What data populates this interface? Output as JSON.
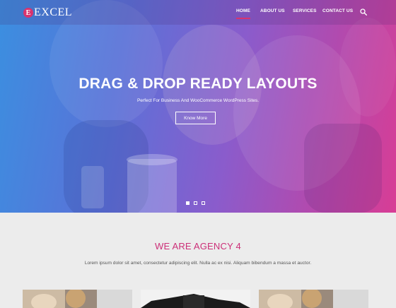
{
  "brand": {
    "badge": "E",
    "name": "EXCEL"
  },
  "nav": [
    {
      "label": "HOME",
      "active": true
    },
    {
      "label": "ABOUT US"
    },
    {
      "label": "SERVICES"
    },
    {
      "label": "CONTACT US"
    }
  ],
  "hero": {
    "title": "DRAG & DROP READY LAYOUTS",
    "subtitle": "Perfect For Business And WooCommerce WordPress Sites.",
    "button": "Know More",
    "slides": 3,
    "active_slide": 1
  },
  "agency": {
    "title": "WE ARE AGENCY 4",
    "text": "Lorem ipsum dolor sit amet, consectetur adipiscing elit. Nulla ac ex nisi. Aliquam bibendum a massa et auctor."
  },
  "colors": {
    "accent": "#cc2f78",
    "gradient_start": "#3b8fe0",
    "gradient_end": "#d83d95"
  }
}
